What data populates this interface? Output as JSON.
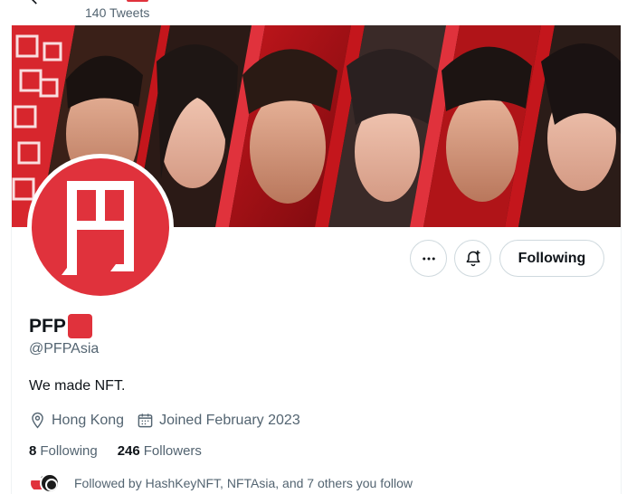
{
  "header": {
    "tweet_count": "140 Tweets"
  },
  "profile": {
    "display_name": "PFP",
    "handle": "@PFPAsia",
    "bio": "We made NFT.",
    "location": "Hong Kong",
    "joined": "Joined February 2023",
    "following_count": "8",
    "following_label": "Following",
    "followers_count": "246",
    "followers_label": "Followers",
    "followed_by": "Followed by HashKeyNFT, NFTAsia, and 7 others you follow",
    "avatar_glyph": "円"
  },
  "actions": {
    "following_button": "Following"
  },
  "colors": {
    "brand_red": "#e0323c",
    "text_primary": "#0f1419",
    "text_secondary": "#536471",
    "border": "#cfd9de"
  },
  "icons": {
    "back": "arrow-left-icon",
    "more": "ellipsis-icon",
    "notify": "bell-plus-icon",
    "location": "location-pin-icon",
    "calendar": "calendar-icon"
  }
}
